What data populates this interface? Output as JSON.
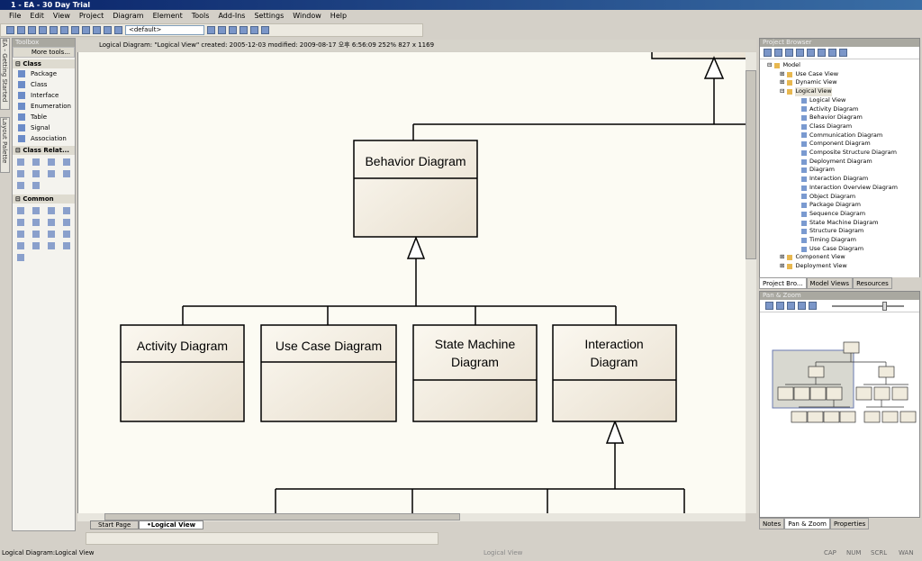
{
  "window": {
    "title": "1 - EA - 30 Day Trial"
  },
  "menu": [
    "File",
    "Edit",
    "View",
    "Project",
    "Diagram",
    "Element",
    "Tools",
    "Add-Ins",
    "Settings",
    "Window",
    "Help"
  ],
  "toolbar": {
    "perspective": "<default>"
  },
  "left_tabs": [
    "EA - Getting Started",
    "Layout Palette"
  ],
  "toolbox": {
    "title": "Toolbox",
    "more_tools": "More tools...",
    "sections": [
      {
        "label": "Class",
        "items": [
          "Package",
          "Class",
          "Interface",
          "Enumeration",
          "Table",
          "Signal",
          "Association"
        ]
      },
      {
        "label": "Class Relat..."
      },
      {
        "label": "Common"
      }
    ]
  },
  "document": {
    "info": "Logical Diagram: \"Logical View\"   created: 2005-12-03  modified: 2009-08-17 오후 6:56:09   252%   827 x 1169",
    "tabs": [
      "Start Page",
      "•Logical View"
    ]
  },
  "diagram": {
    "parent": "Behavior Diagram",
    "children": [
      "Activity Diagram",
      "Use Case Diagram",
      "State Machine Diagram",
      "Interaction Diagram"
    ]
  },
  "project_browser": {
    "title": "Project Browser",
    "root": "Model",
    "views": [
      "Use Case View",
      "Dynamic View",
      "Logical View"
    ],
    "logical_children": [
      "Logical View",
      "Activity Diagram",
      "Behavior Diagram",
      "Class Diagram",
      "Communication Diagram",
      "Component Diagram",
      "Composite Structure Diagram",
      "Deployment Diagram",
      "Diagram",
      "Interaction Diagram",
      "Interaction Overview Diagram",
      "Object Diagram",
      "Package Diagram",
      "Sequence Diagram",
      "State Machine Diagram",
      "Structure Diagram",
      "Timing Diagram",
      "Use Case Diagram"
    ],
    "after": [
      "Component View",
      "Deployment View"
    ],
    "tabs": [
      "Project Bro...",
      "Model Views",
      "Resources"
    ]
  },
  "pan_zoom": {
    "title": "Pan & Zoom",
    "zoom_level": 0.75,
    "tabs": [
      "Notes",
      "Pan & Zoom",
      "Properties"
    ]
  },
  "status": {
    "left": "Logical Diagram:Logical View",
    "center": "Logical View",
    "indicators": [
      "CAP",
      "NUM",
      "SCRL",
      "WAN"
    ]
  }
}
